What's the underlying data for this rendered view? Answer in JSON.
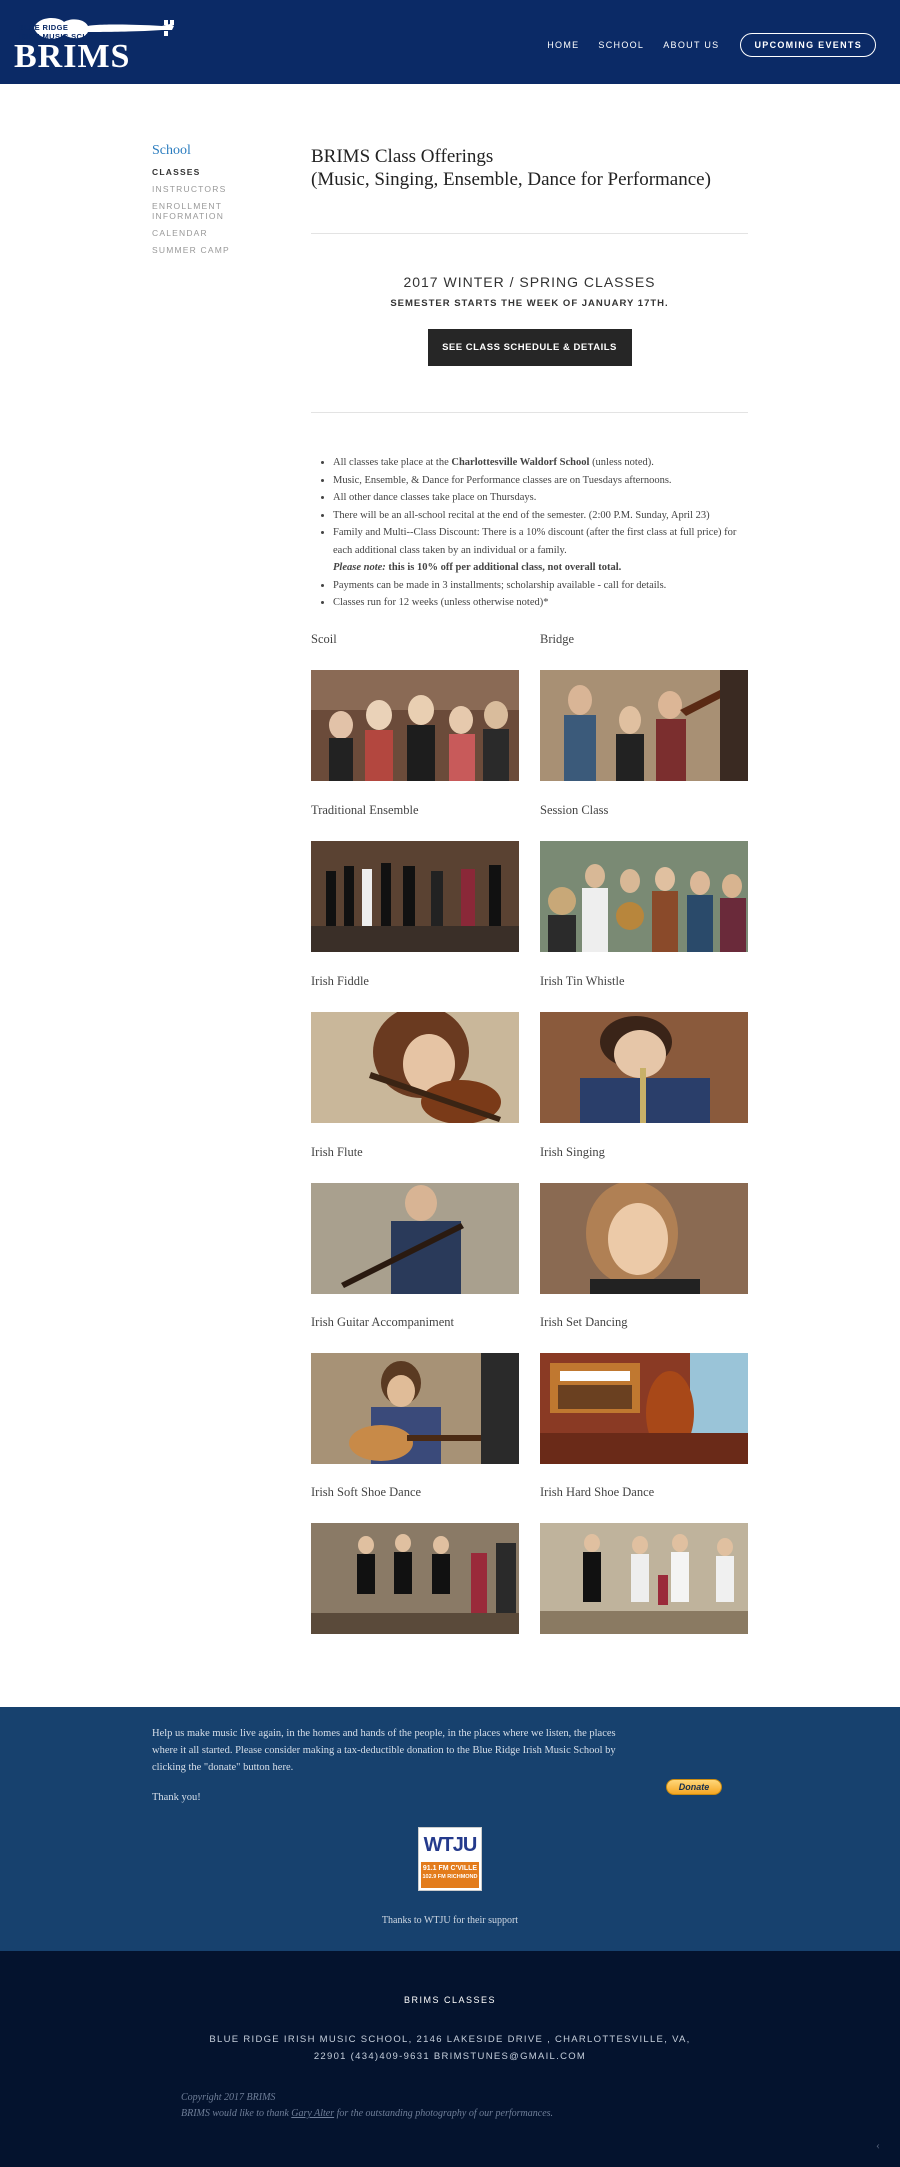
{
  "header": {
    "logo_small": "BLUE RIDGE\nIRISH MUSIC SCHOOL",
    "logo_big": "BRIMS",
    "nav": [
      "HOME",
      "SCHOOL",
      "ABOUT US"
    ],
    "events_button": "UPCOMING EVENTS"
  },
  "sidebar": {
    "title": "School",
    "items": [
      "CLASSES",
      "INSTRUCTORS",
      "ENROLLMENT INFORMATION",
      "CALENDAR",
      "SUMMER CAMP"
    ]
  },
  "main": {
    "title_line1": "BRIMS Class Offerings",
    "title_line2": "(Music, Singing, Ensemble, Dance for Performance)",
    "semester_heading": "2017 WINTER / SPRING CLASSES",
    "semester_sub": "SEMESTER STARTS THE WEEK OF JANUARY 17TH.",
    "schedule_button": "SEE CLASS SCHEDULE & DETAILS",
    "bullets": {
      "b1_pre": "All classes take place at the ",
      "b1_bold": "Charlottesville Waldorf School",
      "b1_post": " (unless noted).",
      "b2": "Music, Ensemble, & Dance for Performance classes are on Tuesdays afternoons.",
      "b3": "All other dance classes take place on Thursdays.",
      "b4": "There will be an all-school recital at the end of the semester. (2:00 P.M. Sunday, April 23)",
      "b5": "Family and Multi--Class Discount:  There is a 10% discount (after the first class at full price) for each additional class taken by an individual or a family.",
      "b5_note_italic": "Please note:",
      "b5_note_bold": " this is 10% off per additional class, not overall total.",
      "b6": "Payments can be made in 3 installments; scholarship available - call for details.",
      "b7": "Classes run for 12 weeks (unless otherwise noted)*"
    },
    "classes": [
      "Scoil",
      "Bridge",
      "Traditional Ensemble",
      "Session Class",
      "Irish Fiddle",
      "Irish Tin Whistle",
      "Irish Flute",
      "Irish Singing",
      "Irish Guitar Accompaniment",
      "Irish Set Dancing",
      "Irish Soft Shoe Dance",
      "Irish Hard Shoe Dance"
    ]
  },
  "donation": {
    "text": "Help us make music live again, in the homes and hands of the people, in the places where we listen, the places where it all started. Please consider making a tax-deductible donation to the Blue Ridge Irish Music School by clicking the \"donate\" button here.",
    "thanks": "Thank you!",
    "donate_button": "Donate",
    "sponsor_logo_text": "WTJU",
    "sponsor_freq1": "91.1 FM C'VILLE",
    "sponsor_freq2": "102.9 FM RICHMOND",
    "sponsor_caption": "Thanks to WTJU for their support"
  },
  "footer": {
    "title": "BRIMS CLASSES",
    "address_line1": "BLUE RIDGE IRISH MUSIC SCHOOL, 2146 LAKESIDE DRIVE , CHARLOTTESVILLE, VA,",
    "address_line2": "22901   (434)409-9631   BRIMSTUNES@GMAIL.COM",
    "copyright": "Copyright 2017 BRIMS",
    "thanks_pre": "BRIMS would like to thank ",
    "thanks_link": "Gary Alter",
    "thanks_post": " for the outstanding photography of our performances."
  },
  "colors": {
    "header_bg": "#0b2a66",
    "band_bg": "#17416e",
    "footer_bg": "#04132e",
    "accent": "#2a7cbf"
  }
}
